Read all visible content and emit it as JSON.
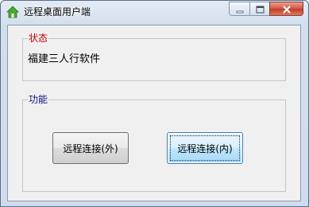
{
  "window": {
    "title": "远程桌面用户端"
  },
  "status_group": {
    "legend": "状态",
    "text": "福建三人行软件"
  },
  "function_group": {
    "legend": "功能",
    "external_button_label": "远程连接(外)",
    "internal_button_label": "远程连接(内)"
  },
  "colors": {
    "status_legend": "#c50000",
    "function_legend": "#101080",
    "close_button": "#c23a24"
  },
  "icons": {
    "app": "house-icon",
    "minimize": "minimize-icon",
    "maximize": "maximize-icon",
    "close": "close-icon"
  }
}
